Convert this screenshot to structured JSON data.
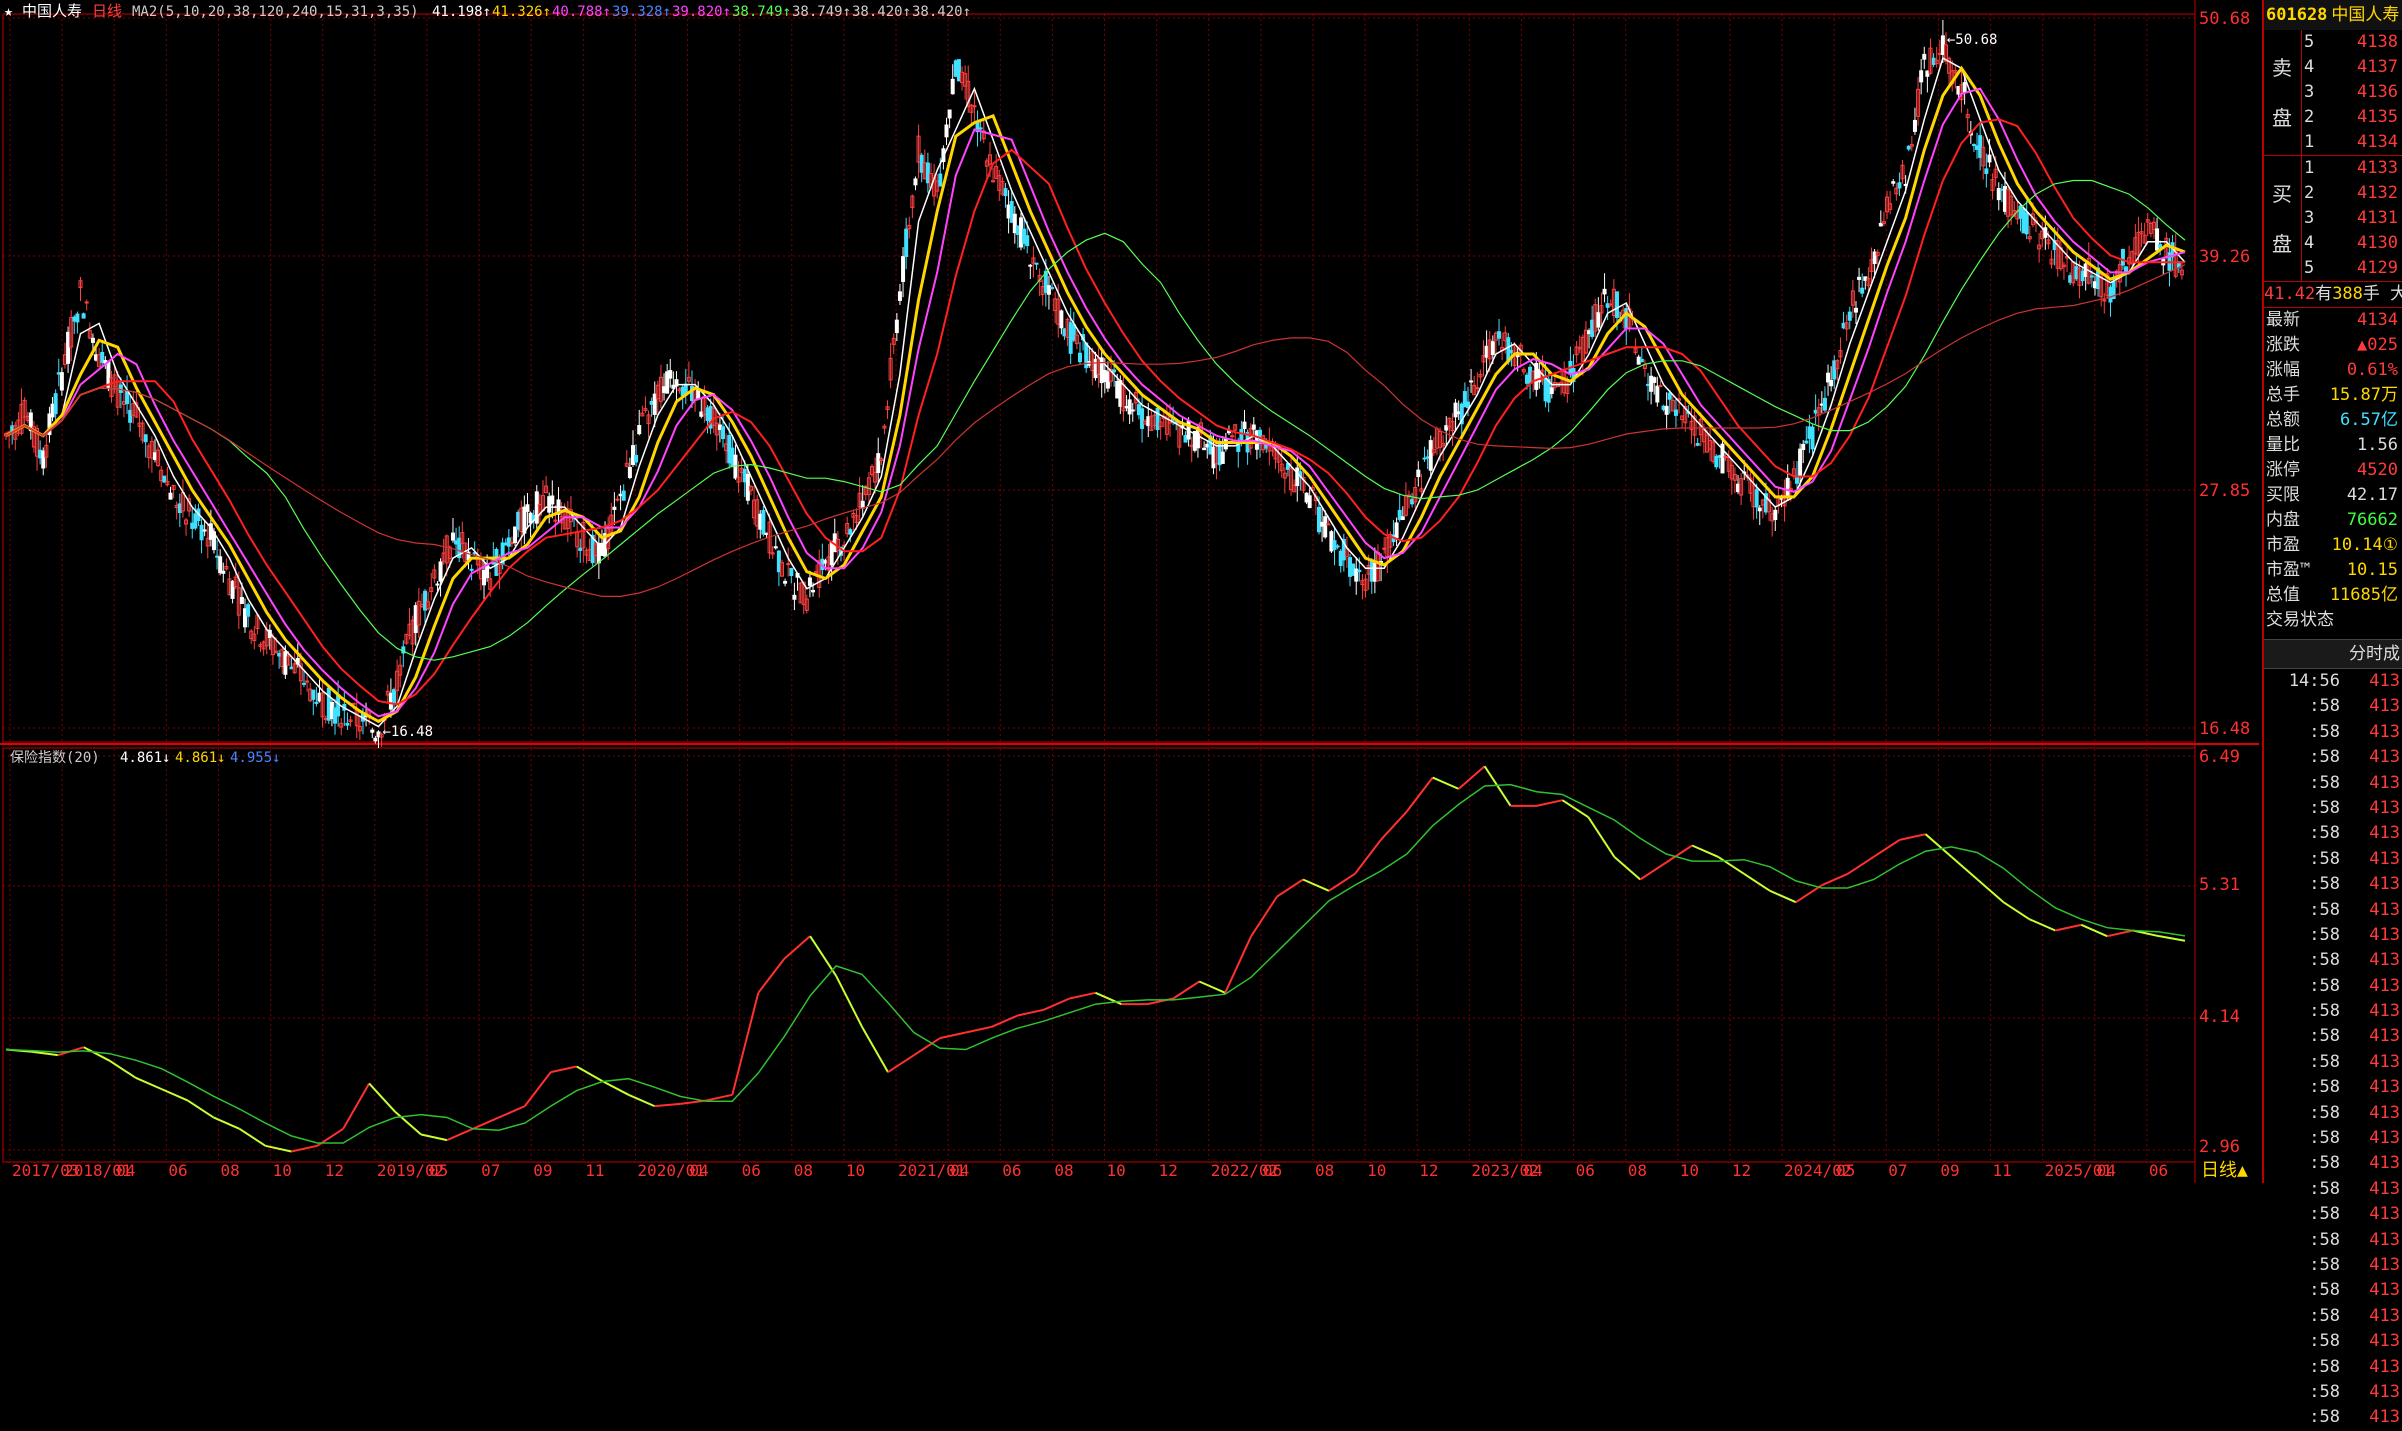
{
  "header": {
    "stock_name": "中国人寿",
    "period": "日线",
    "ma_label": "MA2(5,10,20,38,120,240,15,31,3,35)",
    "ma_values": [
      {
        "text": "41.198↑",
        "color": "#ffffff"
      },
      {
        "text": "41.326↑",
        "color": "#ffd700"
      },
      {
        "text": "40.788↑",
        "color": "#ff44ff"
      },
      {
        "text": "39.328↑",
        "color": "#4488ff"
      },
      {
        "text": "39.820↑",
        "color": "#ff44ff"
      },
      {
        "text": "38.749↑",
        "color": "#55ff55"
      },
      {
        "text": "38.749↑",
        "color": "#cccccc"
      },
      {
        "text": "38.420↑",
        "color": "#cccccc"
      },
      {
        "text": "38.420↑",
        "color": "#cccccc"
      }
    ]
  },
  "price_axis": {
    "labels": [
      "50.68",
      "39.26",
      "27.85",
      "16.48"
    ],
    "colors": {
      "grid": "#7a0000",
      "axis_text": "#ff3030",
      "frame": "#c00000"
    }
  },
  "annotations": {
    "high": "50.68",
    "low": "16.48"
  },
  "sub_indicator": {
    "label": "保险指数(20)",
    "values": [
      {
        "text": "4.861↓",
        "color": "#ffffff"
      },
      {
        "text": "4.861↓",
        "color": "#ffd700"
      },
      {
        "text": "4.955↓",
        "color": "#4488ff"
      }
    ],
    "axis_labels": [
      "6.49",
      "5.31",
      "4.14",
      "2.96"
    ]
  },
  "date_axis": {
    "labels": [
      "2017/03",
      "2018/01",
      "04",
      "06",
      "08",
      "10",
      "12",
      "2019/02",
      "05",
      "07",
      "09",
      "11",
      "2020/01",
      "04",
      "06",
      "08",
      "10",
      "2021/01",
      "04",
      "06",
      "08",
      "10",
      "12",
      "2022/02",
      "06",
      "08",
      "10",
      "12",
      "2023/02",
      "04",
      "06",
      "08",
      "10",
      "12",
      "2024/02",
      "05",
      "07",
      "09",
      "11",
      "2025/01",
      "04",
      "06"
    ],
    "period_button": "日线▲"
  },
  "quote": {
    "code": "601628",
    "name": "中国人寿",
    "sell_label_1": "卖",
    "sell_label_2": "盘",
    "buy_label_1": "买",
    "buy_label_2": "盘",
    "sell_levels": [
      {
        "level": "5",
        "price": "4138"
      },
      {
        "level": "4",
        "price": "4137"
      },
      {
        "level": "3",
        "price": "4136"
      },
      {
        "level": "2",
        "price": "4135"
      },
      {
        "level": "1",
        "price": "4134"
      }
    ],
    "buy_levels": [
      {
        "level": "1",
        "price": "4133"
      },
      {
        "level": "2",
        "price": "4132"
      },
      {
        "level": "3",
        "price": "4131"
      },
      {
        "level": "4",
        "price": "4130"
      },
      {
        "level": "5",
        "price": "4129"
      }
    ],
    "volume_line": {
      "price": "41.42",
      "mid": "有",
      "qty": "388",
      "unit": "手 大"
    },
    "stats": [
      {
        "k": "最新",
        "v": "4134",
        "color": "#ff3b3b"
      },
      {
        "k": "涨跌",
        "v": "▲025",
        "color": "#ff3b3b"
      },
      {
        "k": "涨幅",
        "v": "0.61%",
        "color": "#ff3b3b"
      },
      {
        "k": "总手",
        "v": "15.87万",
        "color": "#ffd700"
      },
      {
        "k": "总额",
        "v": "6.57亿",
        "color": "#40e0ff"
      },
      {
        "k": "量比",
        "v": "1.56",
        "color": "#dddddd"
      },
      {
        "k": "涨停",
        "v": "4520",
        "color": "#ff3b3b"
      },
      {
        "k": "买限",
        "v": "42.17",
        "color": "#dddddd"
      },
      {
        "k": "内盘",
        "v": "76662",
        "color": "#40ff40"
      },
      {
        "k": "市盈",
        "v": "10.14①",
        "color": "#ffd700"
      },
      {
        "k": "市盈™",
        "v": "10.15",
        "color": "#ffd700"
      },
      {
        "k": "总值",
        "v": "11685亿",
        "color": "#ffd700"
      },
      {
        "k": "交易状态",
        "v": "",
        "color": "#dddddd"
      }
    ],
    "ticks_header": "分时成",
    "ticks": [
      {
        "t": "14:56",
        "p": "413"
      },
      {
        "t": ":58",
        "p": "413"
      },
      {
        "t": ":58",
        "p": "413"
      },
      {
        "t": ":58",
        "p": "413"
      },
      {
        "t": ":58",
        "p": "413"
      },
      {
        "t": ":58",
        "p": "413"
      },
      {
        "t": ":58",
        "p": "413"
      },
      {
        "t": ":58",
        "p": "413"
      },
      {
        "t": ":58",
        "p": "413"
      },
      {
        "t": ":58",
        "p": "413"
      },
      {
        "t": ":58",
        "p": "413"
      },
      {
        "t": ":58",
        "p": "413"
      },
      {
        "t": ":58",
        "p": "413"
      },
      {
        "t": ":58",
        "p": "413"
      },
      {
        "t": ":58",
        "p": "413"
      },
      {
        "t": ":58",
        "p": "413"
      },
      {
        "t": ":58",
        "p": "413"
      },
      {
        "t": ":58",
        "p": "413"
      },
      {
        "t": ":58",
        "p": "413"
      },
      {
        "t": ":58",
        "p": "413"
      },
      {
        "t": ":58",
        "p": "413"
      },
      {
        "t": ":58",
        "p": "413"
      },
      {
        "t": ":58",
        "p": "413"
      },
      {
        "t": ":58",
        "p": "413"
      },
      {
        "t": ":58",
        "p": "413"
      },
      {
        "t": ":58",
        "p": "413"
      },
      {
        "t": ":58",
        "p": "413"
      },
      {
        "t": ":58",
        "p": "413"
      },
      {
        "t": ":58",
        "p": "413"
      },
      {
        "t": ":58",
        "p": "413"
      }
    ]
  },
  "price_series": [
    31,
    32,
    30,
    34,
    38,
    35,
    33,
    32,
    30,
    28,
    27,
    26,
    24,
    22,
    21,
    20,
    19,
    18,
    17.5,
    17,
    16.5,
    19,
    22,
    24,
    26,
    25,
    24,
    26,
    27,
    28,
    27,
    26,
    25,
    28,
    31,
    33,
    34,
    33,
    32,
    30,
    28,
    26,
    24,
    23,
    25,
    26,
    28,
    30,
    38,
    45,
    43,
    49,
    47,
    44,
    42,
    40,
    38,
    36,
    35,
    34,
    33,
    32,
    32,
    31,
    31,
    30,
    31,
    31,
    30,
    29,
    28,
    26,
    25,
    24,
    25,
    27,
    29,
    31,
    32,
    34,
    36,
    35,
    34,
    33,
    34,
    36,
    38,
    37,
    34,
    33,
    32,
    31,
    30,
    29,
    28,
    27,
    29,
    31,
    34,
    37,
    39,
    42,
    44,
    49,
    50,
    48,
    45,
    43,
    42,
    41,
    40,
    39,
    39,
    38,
    40,
    41,
    40,
    39
  ],
  "insurance_index": [
    3.9,
    3.88,
    3.85,
    3.92,
    3.8,
    3.65,
    3.55,
    3.45,
    3.3,
    3.2,
    3.05,
    3.0,
    3.05,
    3.2,
    3.6,
    3.35,
    3.15,
    3.1,
    3.2,
    3.3,
    3.4,
    3.7,
    3.75,
    3.62,
    3.5,
    3.4,
    3.42,
    3.45,
    3.5,
    4.4,
    4.7,
    4.9,
    4.55,
    4.1,
    3.7,
    3.85,
    4.0,
    4.05,
    4.1,
    4.2,
    4.25,
    4.35,
    4.4,
    4.3,
    4.3,
    4.35,
    4.5,
    4.4,
    4.9,
    5.25,
    5.4,
    5.3,
    5.45,
    5.75,
    6.0,
    6.3,
    6.2,
    6.4,
    6.05,
    6.05,
    6.1,
    5.95,
    5.6,
    5.4,
    5.55,
    5.7,
    5.6,
    5.45,
    5.3,
    5.2,
    5.35,
    5.45,
    5.6,
    5.75,
    5.8,
    5.6,
    5.4,
    5.2,
    5.05,
    4.95,
    5.0,
    4.9,
    4.95,
    4.9,
    4.86
  ]
}
